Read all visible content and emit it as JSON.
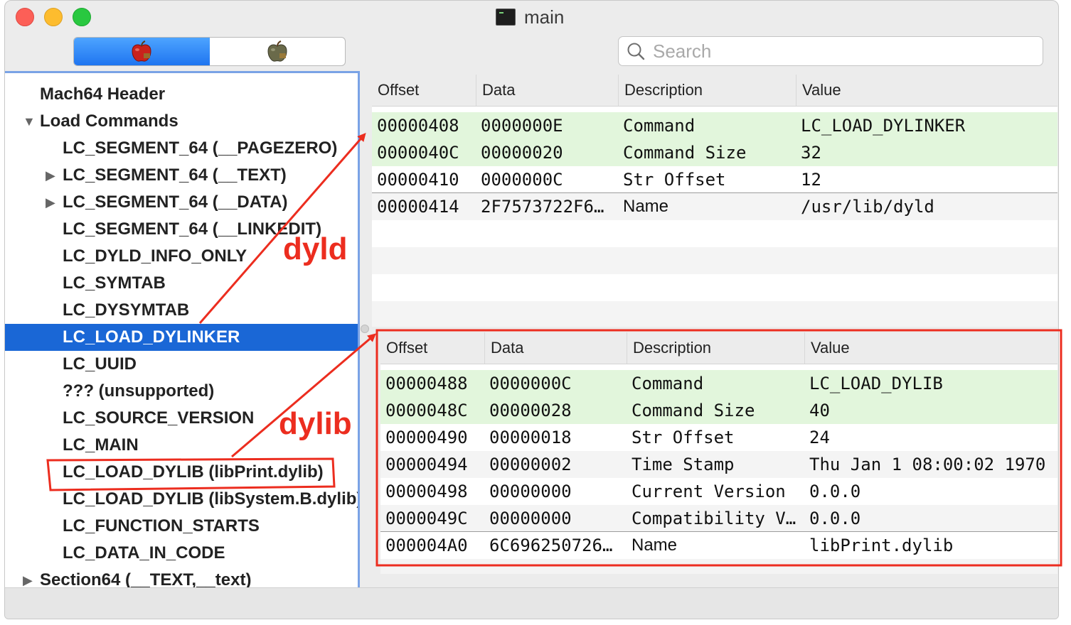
{
  "window": {
    "title": "main"
  },
  "toolbar": {
    "search": {
      "placeholder": "Search",
      "value": ""
    },
    "segments": [
      {
        "icon": "apple-raw-icon",
        "active": true
      },
      {
        "icon": "apple-rva-icon",
        "active": false
      }
    ]
  },
  "sidebar": {
    "items": [
      {
        "label": "Mach64 Header",
        "level": 0,
        "disclosure": "none"
      },
      {
        "label": "Load Commands",
        "level": 0,
        "disclosure": "open"
      },
      {
        "label": "LC_SEGMENT_64 (__PAGEZERO)",
        "level": 1,
        "disclosure": "none"
      },
      {
        "label": "LC_SEGMENT_64 (__TEXT)",
        "level": 1,
        "disclosure": "closed"
      },
      {
        "label": "LC_SEGMENT_64 (__DATA)",
        "level": 1,
        "disclosure": "closed"
      },
      {
        "label": "LC_SEGMENT_64 (__LINKEDIT)",
        "level": 1,
        "disclosure": "none"
      },
      {
        "label": "LC_DYLD_INFO_ONLY",
        "level": 1,
        "disclosure": "none"
      },
      {
        "label": "LC_SYMTAB",
        "level": 1,
        "disclosure": "none"
      },
      {
        "label": "LC_DYSYMTAB",
        "level": 1,
        "disclosure": "none"
      },
      {
        "label": "LC_LOAD_DYLINKER",
        "level": 1,
        "disclosure": "none",
        "selected": true
      },
      {
        "label": "LC_UUID",
        "level": 1,
        "disclosure": "none"
      },
      {
        "label": "??? (unsupported)",
        "level": 1,
        "disclosure": "none"
      },
      {
        "label": "LC_SOURCE_VERSION",
        "level": 1,
        "disclosure": "none"
      },
      {
        "label": "LC_MAIN",
        "level": 1,
        "disclosure": "none"
      },
      {
        "label": "LC_LOAD_DYLIB (libPrint.dylib)",
        "level": 1,
        "disclosure": "none"
      },
      {
        "label": "LC_LOAD_DYLIB (libSystem.B.dylib)",
        "level": 1,
        "disclosure": "none"
      },
      {
        "label": "LC_FUNCTION_STARTS",
        "level": 1,
        "disclosure": "none"
      },
      {
        "label": "LC_DATA_IN_CODE",
        "level": 1,
        "disclosure": "none"
      },
      {
        "label": "Section64 (__TEXT,__text)",
        "level": 0,
        "disclosure": "closed"
      }
    ]
  },
  "table_top": {
    "columns": [
      "Offset",
      "Data",
      "Description",
      "Value"
    ],
    "rows": [
      {
        "offset": "00000408",
        "data": "0000000E",
        "description": "Command",
        "value": "LC_LOAD_DYLINKER",
        "style": "green"
      },
      {
        "offset": "0000040C",
        "data": "00000020",
        "description": "Command Size",
        "value": "32",
        "style": "green"
      },
      {
        "offset": "00000410",
        "data": "0000000C",
        "description": "Str Offset",
        "value": "12",
        "style": "white-sep"
      },
      {
        "offset": "00000414",
        "data": "2F7573722F6…",
        "description": "Name",
        "value": "/usr/lib/dyld",
        "style": "gray"
      }
    ]
  },
  "table_bottom": {
    "columns": [
      "Offset",
      "Data",
      "Description",
      "Value"
    ],
    "rows": [
      {
        "offset": "00000488",
        "data": "0000000C",
        "description": "Command",
        "value": "LC_LOAD_DYLIB",
        "style": "green"
      },
      {
        "offset": "0000048C",
        "data": "00000028",
        "description": "Command Size",
        "value": "40",
        "style": "green"
      },
      {
        "offset": "00000490",
        "data": "00000018",
        "description": "Str Offset",
        "value": "24",
        "style": "white"
      },
      {
        "offset": "00000494",
        "data": "00000002",
        "description": "Time Stamp",
        "value": "Thu Jan  1 08:00:02 1970",
        "style": "gray"
      },
      {
        "offset": "00000498",
        "data": "00000000",
        "description": "Current Version",
        "value": "0.0.0",
        "style": "white"
      },
      {
        "offset": "0000049C",
        "data": "00000000",
        "description": "Compatibility V…",
        "value": "0.0.0",
        "style": "gray-sep"
      },
      {
        "offset": "000004A0",
        "data": "6C696250726…",
        "description": "Name",
        "value": "libPrint.dylib",
        "style": "white"
      }
    ]
  },
  "annotations": {
    "dyld_label": "dyld",
    "dylib_label": "dylib",
    "color": "#ec2d1f"
  },
  "colors": {
    "selection": "#1a67d6",
    "highlight_row": "#e2f6dc",
    "sidebar_border": "#7aa3e6"
  }
}
